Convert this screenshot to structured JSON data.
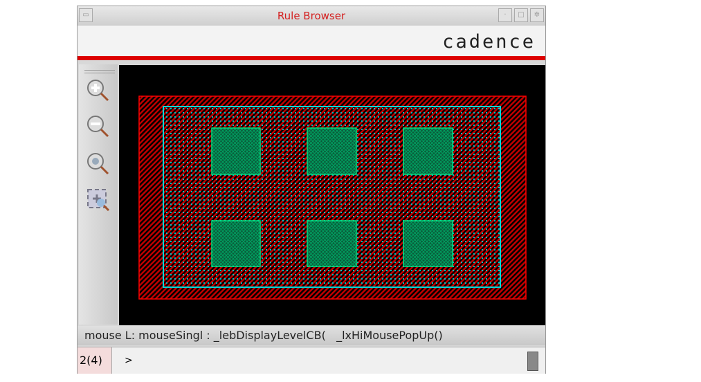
{
  "window": {
    "title": "Rule Browser"
  },
  "header": {
    "logo": "cadence"
  },
  "toolbar": {
    "tools": [
      "zoom-in",
      "zoom-out",
      "zoom-fit",
      "zoom-area"
    ]
  },
  "status": {
    "text": "mouse L: mouseSingl : _lebDisplayLevelCB(   _lxHiMousePopUp()"
  },
  "command": {
    "count": "2(4)",
    "prompt": ">"
  },
  "colors": {
    "outer": "#ff0000",
    "inner": "#00d8d8",
    "via": "#00e080",
    "title": "#d42020"
  }
}
